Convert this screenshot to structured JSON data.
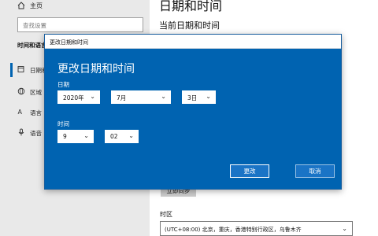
{
  "sidebar": {
    "home_label": "主页",
    "search_placeholder": "查找设置",
    "section_title": "时间和语言",
    "items": [
      {
        "label": "日期和时间",
        "icon": "calendar-clock-icon"
      },
      {
        "label": "区域",
        "icon": "globe-icon"
      },
      {
        "label": "语言",
        "icon": "language-icon"
      },
      {
        "label": "语音",
        "icon": "microphone-icon"
      }
    ]
  },
  "main": {
    "title": "日期和时间",
    "subtitle": "当前日期和时间",
    "sync_button": "立即同步",
    "timezone_label": "时区",
    "timezone_value": "(UTC+08:00) 北京，重庆，香港特别行政区，乌鲁木齐"
  },
  "dialog": {
    "window_title": "更改日期和时间",
    "heading": "更改日期和时间",
    "date_label": "日期",
    "year": "2020年",
    "month": "7月",
    "day": "3日",
    "time_label": "时间",
    "hour": "9",
    "minute": "02",
    "change_button": "更改",
    "cancel_button": "取消"
  },
  "colors": {
    "dialog_bg": "#0063b1",
    "sidebar_bg": "#e9e9e9",
    "accent": "#0063b1"
  }
}
